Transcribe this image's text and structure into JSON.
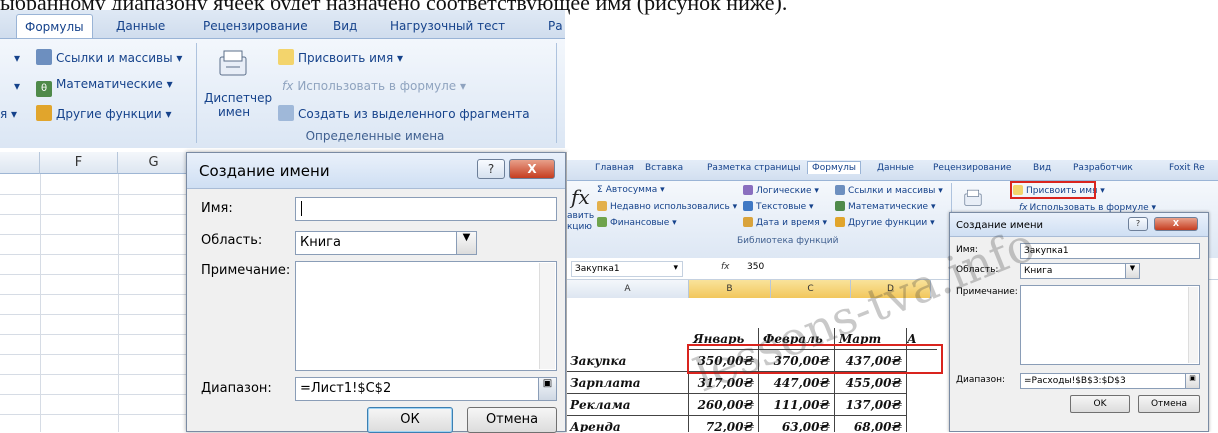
{
  "caption_fragment": "ыбранному диапазону ячеек будет назначено соответствующее имя (рисунок ниже).",
  "ribbon": {
    "tabs": [
      "Формулы",
      "Данные",
      "Рецензирование",
      "Вид",
      "Нагрузочный тест",
      "Ра"
    ],
    "active_tab": "Формулы",
    "items": {
      "refs": "Ссылки и массивы",
      "math": "Математические",
      "other": "Другие функции",
      "manager_line1": "Диспетчер",
      "manager_line2": "имен",
      "assign_name": "Присвоить имя",
      "use_in_formula": "Использовать в формуле",
      "create_from_selection": "Создать из выделенного фрагмента",
      "left_cut": "я"
    },
    "group_label": "Определенные имена"
  },
  "sheet": {
    "columns": [
      "F",
      "G"
    ]
  },
  "dialog": {
    "title": "Создание имени",
    "help_btn": "?",
    "close_btn": "X",
    "name_label": "Имя:",
    "name_value": "",
    "scope_label": "Область:",
    "scope_value": "Книга",
    "comment_label": "Примечание:",
    "comment_value": "",
    "range_label": "Диапазон:",
    "range_value": "=Лист1!$C$2",
    "ok": "ОК",
    "cancel": "Отмена"
  },
  "right": {
    "tabs": [
      "Главная",
      "Вставка",
      "Разметка страницы",
      "Формулы",
      "Данные",
      "Рецензирование",
      "Вид",
      "Разработчик",
      "Foxit Re"
    ],
    "active_tab": "Формулы",
    "ribbon": {
      "autosum": "Автосумма",
      "recent": "Недавно использовались",
      "financial": "Финансовые",
      "logical": "Логические",
      "text": "Текстовые",
      "datetime": "Дата и время",
      "refs": "Ссылки и массивы",
      "math": "Математические",
      "other": "Другие функции",
      "insert_fn_1": "авить",
      "insert_fn_2": "кцию",
      "lib_label": "Библиотека функций",
      "assign_name": "Присвоить имя",
      "use_in_formula": "Использовать в формуле"
    },
    "formula_bar": {
      "name_box": "Закупка1",
      "fx": "fx",
      "value": "350"
    },
    "col_headers": [
      "A",
      "B",
      "C",
      "D"
    ],
    "table": {
      "headers": [
        "Январь",
        "Февраль",
        "Март"
      ],
      "rows": [
        {
          "name": "Закупка",
          "values": [
            "350,00₴",
            "370,00₴",
            "437,00₴"
          ]
        },
        {
          "name": "Зарплата",
          "values": [
            "317,00₴",
            "447,00₴",
            "455,00₴"
          ]
        },
        {
          "name": "Реклама",
          "values": [
            "260,00₴",
            "111,00₴",
            "137,00₴"
          ]
        },
        {
          "name": "Аренда",
          "values": [
            "72,00₴",
            "63,00₴",
            "68,00₴"
          ]
        }
      ],
      "cut_letter": "А"
    },
    "dialog": {
      "title": "Создание имени",
      "name_label": "Имя:",
      "name_value": "Закупка1",
      "scope_label": "Область:",
      "scope_value": "Книга",
      "comment_label": "Примечание:",
      "range_label": "Диапазон:",
      "range_value": "=Расходы!$B$3:$D$3",
      "ok": "OK",
      "cancel": "Отмена"
    },
    "watermark": "lessons-tva.info"
  }
}
